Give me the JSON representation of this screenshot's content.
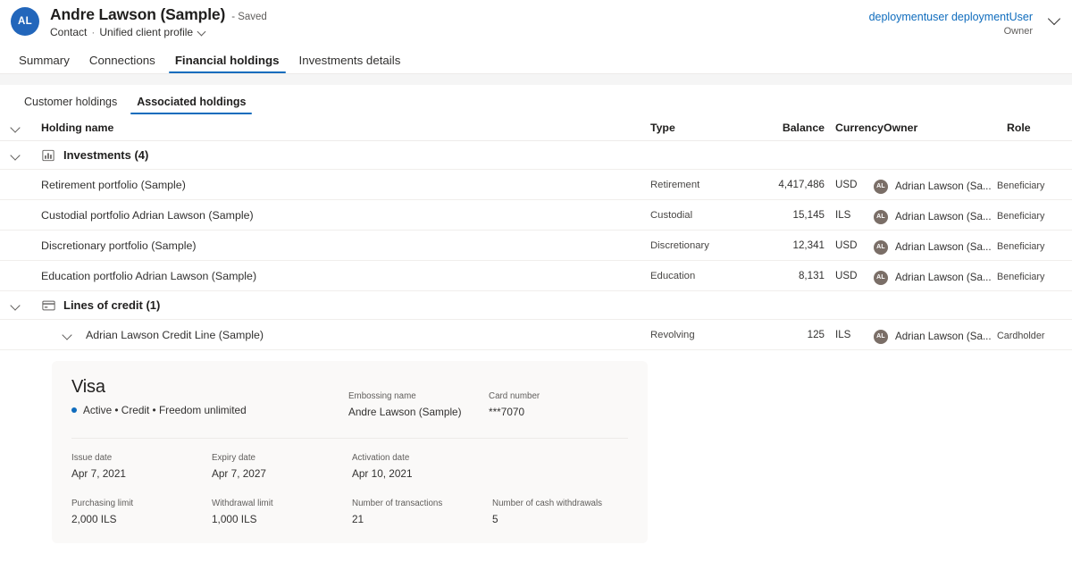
{
  "header": {
    "avatar_initials": "AL",
    "record_title": "Andre Lawson (Sample)",
    "saved_state": "- Saved",
    "entity_type": "Contact",
    "separator": "·",
    "form_name": "Unified client profile",
    "owner_name": "deploymentuser deploymentUser",
    "owner_role": "Owner"
  },
  "main_tabs": [
    {
      "label": "Summary",
      "active": false
    },
    {
      "label": "Connections",
      "active": false
    },
    {
      "label": "Financial holdings",
      "active": true
    },
    {
      "label": "Investments details",
      "active": false
    }
  ],
  "sub_tabs": [
    {
      "label": "Customer holdings",
      "active": false
    },
    {
      "label": "Associated holdings",
      "active": true
    }
  ],
  "table": {
    "columns": {
      "name": "Holding name",
      "type": "Type",
      "balance": "Balance",
      "currency": "Currency",
      "owner": "Owner",
      "role": "Role"
    },
    "groups": [
      {
        "icon": "bar-chart-icon",
        "label": "Investments (4)",
        "rows": [
          {
            "name": "Retirement portfolio (Sample)",
            "type": "Retirement",
            "balance": "4,417,486",
            "currency": "USD",
            "owner_initials": "AL",
            "owner": "Adrian Lawson (Sa...",
            "role": "Beneficiary",
            "expandable": false
          },
          {
            "name": "Custodial portfolio Adrian Lawson (Sample)",
            "type": "Custodial",
            "balance": "15,145",
            "currency": "ILS",
            "owner_initials": "AL",
            "owner": "Adrian Lawson (Sa...",
            "role": "Beneficiary",
            "expandable": false
          },
          {
            "name": "Discretionary portfolio (Sample)",
            "type": "Discretionary",
            "balance": "12,341",
            "currency": "USD",
            "owner_initials": "AL",
            "owner": "Adrian Lawson (Sa...",
            "role": "Beneficiary",
            "expandable": false
          },
          {
            "name": "Education portfolio Adrian Lawson (Sample)",
            "type": "Education",
            "balance": "8,131",
            "currency": "USD",
            "owner_initials": "AL",
            "owner": "Adrian Lawson (Sa...",
            "role": "Beneficiary",
            "expandable": false
          }
        ]
      },
      {
        "icon": "credit-card-icon",
        "label": "Lines of credit (1)",
        "rows": [
          {
            "name": "Adrian Lawson Credit Line (Sample)",
            "type": "Revolving",
            "balance": "125",
            "currency": "ILS",
            "owner_initials": "AL",
            "owner": "Adrian Lawson (Sa...",
            "role": "Cardholder",
            "expandable": true
          }
        ]
      }
    ]
  },
  "card_detail": {
    "brand": "Visa",
    "status_line": "Active • Credit • Freedom unlimited",
    "status_color": "#0f6cbd",
    "top_fields": [
      {
        "label": "Embossing name",
        "value": "Andre Lawson (Sample)"
      },
      {
        "label": "Card number",
        "value": "***7070"
      }
    ],
    "row1": [
      {
        "label": "Issue date",
        "value": "Apr 7, 2021"
      },
      {
        "label": "Expiry date",
        "value": "Apr 7, 2027"
      },
      {
        "label": "Activation date",
        "value": "Apr 10, 2021"
      }
    ],
    "row2": [
      {
        "label": "Purchasing limit",
        "value": "2,000 ILS"
      },
      {
        "label": "Withdrawal limit",
        "value": "1,000 ILS"
      },
      {
        "label": "Number of transactions",
        "value": "21"
      },
      {
        "label": "Number of cash withdrawals",
        "value": "5"
      }
    ]
  }
}
